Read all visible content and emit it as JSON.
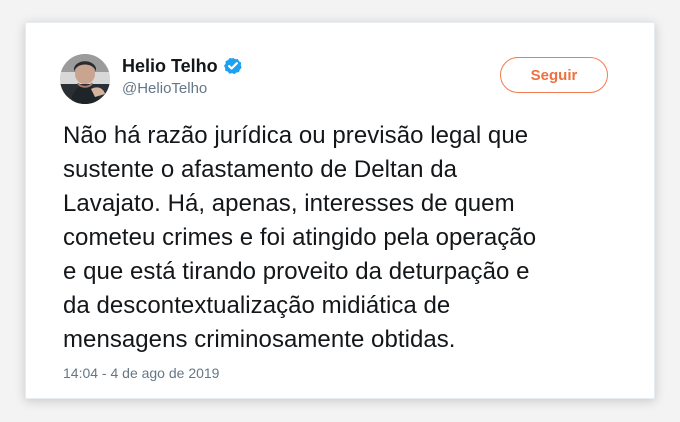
{
  "tweet": {
    "author": {
      "display_name": "Helio Telho",
      "handle": "@HelioTelho",
      "verified_icon": "verified-badge-icon",
      "avatar_icon": "profile-avatar-icon"
    },
    "follow_button": {
      "label": "Seguir"
    },
    "text": "Não há razão jurídica ou previsão legal que\nsustente o afastamento de Deltan da\nLavajato. Há, apenas, interesses de quem\ncometeu crimes e foi atingido pela operação\ne que está tirando proveito da deturpação e\nda descontextualização  midiática de\nmensagens criminosamente obtidas.",
    "timestamp": "14:04 - 4 de ago de 2019"
  },
  "colors": {
    "background": "#f3f3f3",
    "card": "#ffffff",
    "text": "#14171a",
    "muted": "#657786",
    "verified": "#1da1f2",
    "follow_accent": "#f06f3d"
  }
}
